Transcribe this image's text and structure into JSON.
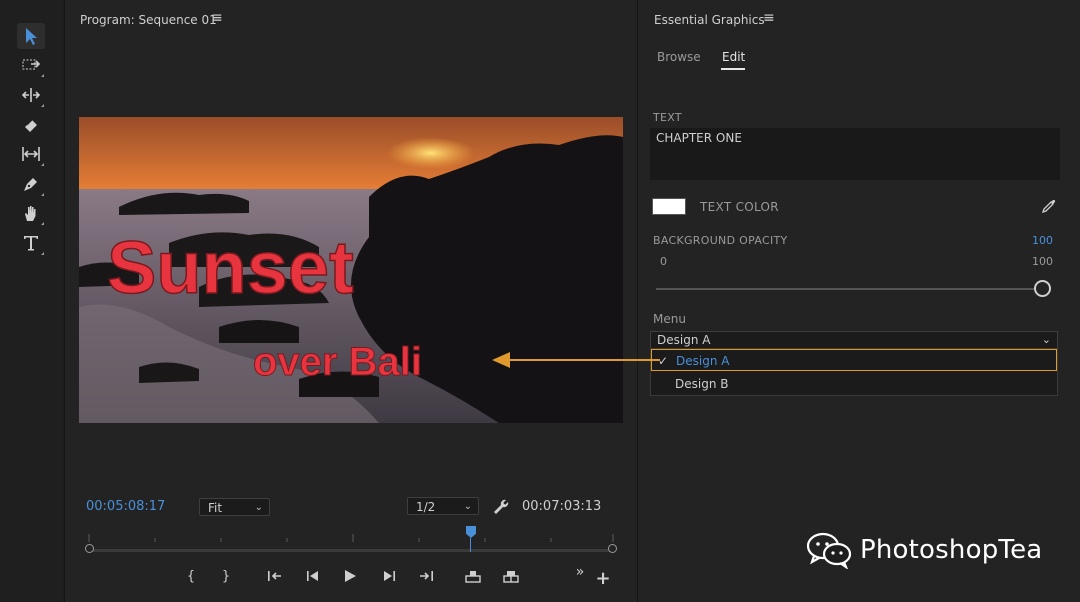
{
  "program": {
    "title": "Program: Sequence 01",
    "current_timecode": "00:05:08:17",
    "fit_label": "Fit",
    "resolution_label": "1/2",
    "duration_timecode": "00:07:03:13",
    "overlay_title": "Sunset",
    "overlay_subtitle": "over Bali"
  },
  "essential_graphics": {
    "title": "Essential Graphics",
    "tabs": [
      {
        "label": "Browse",
        "active": false
      },
      {
        "label": "Edit",
        "active": true
      }
    ],
    "text_label": "TEXT",
    "text_value": "CHAPTER ONE",
    "text_color_label": "TEXT COLOR",
    "text_color": "#ffffff",
    "bg_opacity_label": "BACKGROUND OPACITY",
    "bg_opacity_value": "100",
    "slider_min": "0",
    "slider_max": "100",
    "slider_value": 100,
    "menu_label": "Menu",
    "menu_selected": "Design A",
    "menu_options": [
      {
        "label": "Design A",
        "selected": true
      },
      {
        "label": "Design B",
        "selected": false
      }
    ]
  },
  "tools": [
    "selection-tool-icon",
    "track-select-tool-icon",
    "ripple-edit-tool-icon",
    "razor-tool-icon",
    "slip-tool-icon",
    "pen-tool-icon",
    "hand-tool-icon",
    "type-tool-icon"
  ],
  "watermark": {
    "text": "PhotoshopTea"
  },
  "colors": {
    "accent_blue": "#4a90d9",
    "highlight_orange": "#e09a2e",
    "title_red": "#e8343f"
  }
}
